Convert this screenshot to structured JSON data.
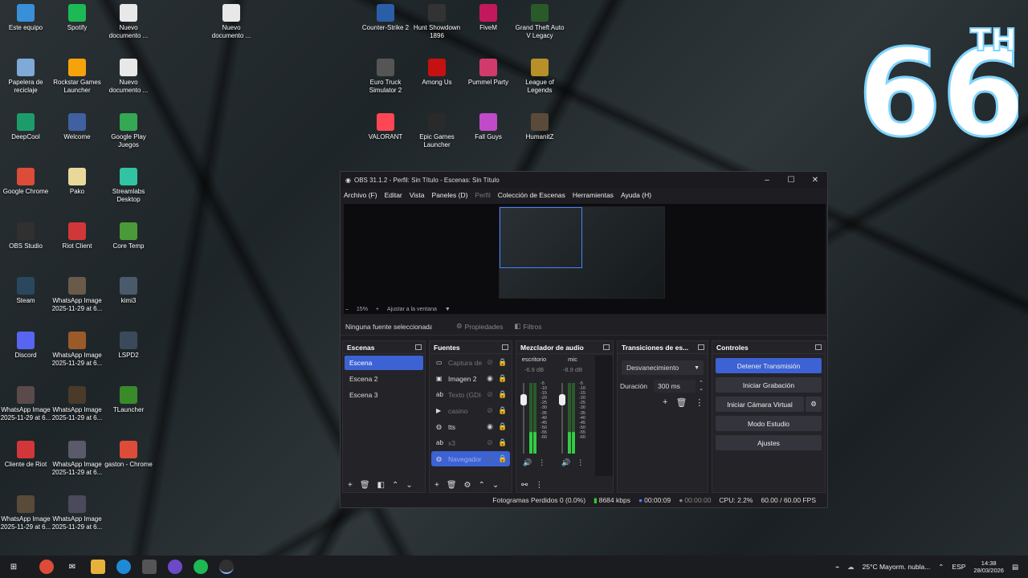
{
  "desktop": {
    "icons": [
      {
        "label": "Este equipo",
        "icon": "computer-icon",
        "color": "#3a8fd9"
      },
      {
        "label": "Spotify",
        "icon": "spotify-icon",
        "color": "#1db954"
      },
      {
        "label": "Nuevo documento ...",
        "icon": "document-icon",
        "color": "#e8e8e8"
      },
      {
        "label": "Nuevo documento ...",
        "icon": "document-icon",
        "color": "#e8e8e8"
      },
      {
        "label": "Counter-Strike 2",
        "icon": "cs2-icon",
        "color": "#2b5ea8"
      },
      {
        "label": "Hunt Showdown 1896",
        "icon": "hunt-icon",
        "color": "#333333"
      },
      {
        "label": "FiveM",
        "icon": "fivem-icon",
        "color": "#c4185c"
      },
      {
        "label": "Grand Theft Auto V Legacy",
        "icon": "gta-icon",
        "color": "#2a5a2a"
      },
      {
        "label": "Papelera de reciclaje",
        "icon": "recycle-bin-icon",
        "color": "#7fa9d6"
      },
      {
        "label": "Rockstar Games Launcher",
        "icon": "rockstar-icon",
        "color": "#f4a30a"
      },
      {
        "label": "Nuevo documento ...",
        "icon": "document-icon",
        "color": "#e8e8e8"
      },
      {
        "label": "Euro Truck Simulator 2",
        "icon": "ets2-icon",
        "color": "#555555"
      },
      {
        "label": "Among Us",
        "icon": "among-us-icon",
        "color": "#c51111"
      },
      {
        "label": "Pummel Party",
        "icon": "pummel-party-icon",
        "color": "#d13b6b"
      },
      {
        "label": "League of Legends",
        "icon": "lol-icon",
        "color": "#b8902a"
      },
      {
        "label": "DeepCool",
        "icon": "deepcool-icon",
        "color": "#1c9c6a"
      },
      {
        "label": "Welcome",
        "icon": "welcome-icon",
        "color": "#4060a0"
      },
      {
        "label": "Google Play Juegos",
        "icon": "google-play-icon",
        "color": "#34a853"
      },
      {
        "label": "VALORANT",
        "icon": "valorant-icon",
        "color": "#ff4655"
      },
      {
        "label": "Epic Games Launcher",
        "icon": "epic-games-icon",
        "color": "#2a2a2a"
      },
      {
        "label": "Fall Guys",
        "icon": "fall-guys-icon",
        "color": "#c04ac8"
      },
      {
        "label": "HumanitZ",
        "icon": "humanitz-icon",
        "color": "#5a4a3a"
      },
      {
        "label": "Google Chrome",
        "icon": "chrome-icon",
        "color": "#dd4b39"
      },
      {
        "label": "Pako",
        "icon": "file-icon",
        "color": "#e8d89a"
      },
      {
        "label": "Streamlabs Desktop",
        "icon": "streamlabs-icon",
        "color": "#31c3a2"
      },
      {
        "label": "OBS Studio",
        "icon": "obs-icon",
        "color": "#303030"
      },
      {
        "label": "Riot Client",
        "icon": "riot-icon",
        "color": "#d13639"
      },
      {
        "label": "Core Temp",
        "icon": "core-temp-icon",
        "color": "#4a9a3a"
      },
      {
        "label": "Steam",
        "icon": "steam-icon",
        "color": "#2a475e"
      },
      {
        "label": "WhatsApp Image 2025-11-29 at 6...",
        "icon": "image-icon",
        "color": "#6a5a4a"
      },
      {
        "label": "kimi3",
        "icon": "image-icon",
        "color": "#4a5a6a"
      },
      {
        "label": "Discord",
        "icon": "discord-icon",
        "color": "#5865f2"
      },
      {
        "label": "WhatsApp Image 2025-11-29 at 6...",
        "icon": "image-icon",
        "color": "#9a5a2a"
      },
      {
        "label": "LSPD2",
        "icon": "image-icon",
        "color": "#3a4a5a"
      },
      {
        "label": "WhatsApp Image 2025-11-29 at 6...",
        "icon": "image-icon",
        "color": "#5a4a4a"
      },
      {
        "label": "WhatsApp Image 2025-11-29 at 6...",
        "icon": "image-icon",
        "color": "#4a3a2a"
      },
      {
        "label": "TLauncher",
        "icon": "tlauncher-icon",
        "color": "#3a8a2a"
      },
      {
        "label": "Cliente de Riot",
        "icon": "riot-icon",
        "color": "#d13639"
      },
      {
        "label": "WhatsApp Image 2025-11-29 at 6...",
        "icon": "image-icon",
        "color": "#5a5a6a"
      },
      {
        "label": "gaston - Chrome",
        "icon": "chrome-icon",
        "color": "#dd4b39"
      },
      {
        "label": "WhatsApp Image 2025-11-29 at 6...",
        "icon": "image-icon",
        "color": "#5a4a3a"
      },
      {
        "label": "WhatsApp Image 2025-11-29 at 6...",
        "icon": "image-icon",
        "color": "#4a4a5a"
      }
    ],
    "logo_text": "66",
    "logo_sup": "TH"
  },
  "obs": {
    "title": "OBS 31.1.2 - Perfil: Sin Título - Escenas: Sin Título",
    "menu": [
      "Archivo (F)",
      "Editar",
      "Vista",
      "Paneles (D)",
      "Perfil",
      "Colección de Escenas",
      "Herramientas",
      "Ayuda (H)"
    ],
    "zoom": "15%",
    "fit_label": "Ajustar a la ventana",
    "no_source": "Ninguna fuente seleccionada",
    "properties": "Propiedades",
    "filters": "Filtros",
    "scenes_title": "Escenas",
    "scenes": [
      "Escena",
      "Escena 2",
      "Escena 3"
    ],
    "sources_title": "Fuentes",
    "sources": [
      {
        "name": "Captura de pantalla",
        "icon": "monitor-icon",
        "visible": false
      },
      {
        "name": "Imagen 2",
        "icon": "image-icon",
        "visible": true
      },
      {
        "name": "Texto (GDI+)",
        "icon": "text-icon",
        "visible": false
      },
      {
        "name": "casino",
        "icon": "media-icon",
        "visible": false
      },
      {
        "name": "tts",
        "icon": "browser-icon",
        "visible": true
      },
      {
        "name": "x3",
        "icon": "text-icon",
        "visible": false
      },
      {
        "name": "Navegador",
        "icon": "browser-icon",
        "visible": false
      }
    ],
    "mixer_title": "Mezclador de audio",
    "mixer": [
      {
        "name": "escritorio",
        "db": "-6.9 dB"
      },
      {
        "name": "mic",
        "db": "-8.9 dB"
      }
    ],
    "meter_scale": [
      "-5",
      "-10",
      "-15",
      "-20",
      "-25",
      "-30",
      "-35",
      "-40",
      "-45",
      "-50",
      "-55",
      "-60"
    ],
    "transitions_title": "Transiciones de es...",
    "transition": "Desvanecimiento",
    "duration_label": "Duración",
    "duration_value": "300 ms",
    "controls_title": "Controles",
    "controls": {
      "stop_stream": "Detener Transmisión",
      "start_rec": "Iniciar Grabación",
      "virtual_cam": "Iniciar Cámara Virtual",
      "studio": "Modo Estudio",
      "settings": "Ajustes"
    },
    "status": {
      "dropped": "Fotogramas Perdidos 0 (0.0%)",
      "bitrate": "8684 kbps",
      "stream_time": "00:00:09",
      "rec_time": "00:00:00",
      "cpu": "CPU: 2.2%",
      "fps": "60.00 / 60.00 FPS"
    },
    "accent": "#3c62d4"
  },
  "taskbar": {
    "weather": "25°C  Mayorm. nubla...",
    "lang": "ESP",
    "time": "14:38",
    "date": "28/03/2026"
  }
}
